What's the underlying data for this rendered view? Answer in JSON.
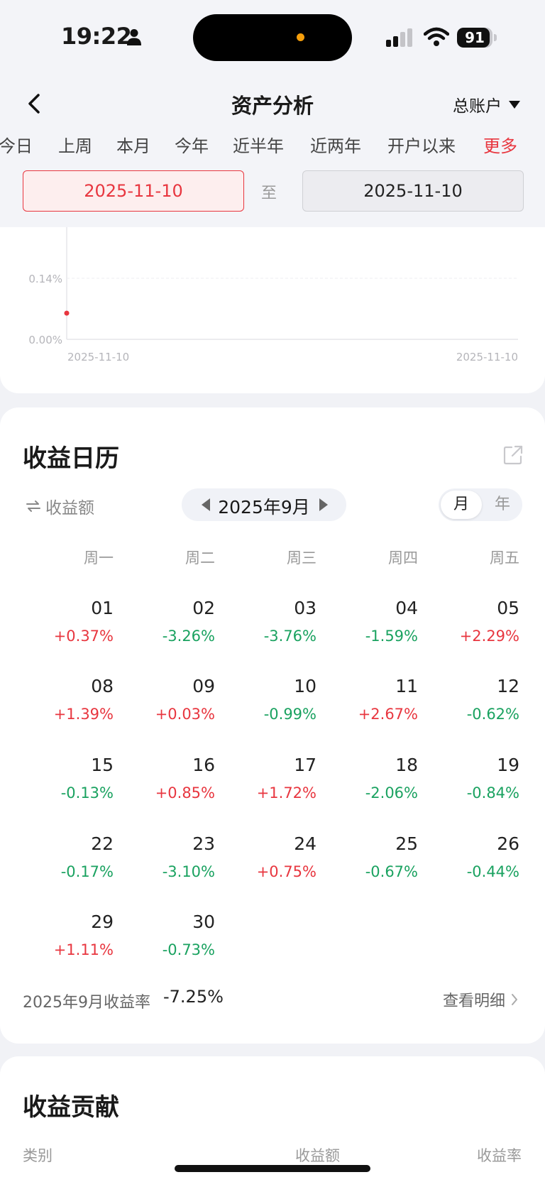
{
  "status_bar": {
    "time": "19:22",
    "battery": "91",
    "battery_level": 0.91
  },
  "header": {
    "title": "资产分析",
    "account": "总账户"
  },
  "period_tabs": [
    {
      "label": "今日",
      "active": false
    },
    {
      "label": "上周",
      "active": false
    },
    {
      "label": "本月",
      "active": false
    },
    {
      "label": "今年",
      "active": false
    },
    {
      "label": "近半年",
      "active": false
    },
    {
      "label": "近两年",
      "active": false
    },
    {
      "label": "开户以来",
      "active": false
    },
    {
      "label": "更多",
      "active": true
    }
  ],
  "date_range": {
    "start": "2025-11-10",
    "separator": "至",
    "end": "2025-11-10"
  },
  "chart_data": {
    "type": "line",
    "y_ticks": [
      "0.14%",
      "0.00%"
    ],
    "ylim": [
      0,
      0.14
    ],
    "x_ticks": [
      "2025-11-10",
      "2025-11-10"
    ],
    "series": [
      {
        "color": "#e8363f",
        "x": [
          "2025-11-10"
        ],
        "y": [
          0.06
        ]
      }
    ]
  },
  "calendar": {
    "title": "收益日历",
    "metric_toggle": "收益额",
    "month": "2025年9月",
    "granularity_month": "月",
    "granularity_year": "年",
    "weekdays": [
      "周一",
      "周二",
      "周三",
      "周四",
      "周五"
    ],
    "weeks": [
      [
        {
          "day": "01",
          "pct": "+0.37%"
        },
        {
          "day": "02",
          "pct": "-3.26%"
        },
        {
          "day": "03",
          "pct": "-3.76%"
        },
        {
          "day": "04",
          "pct": "-1.59%"
        },
        {
          "day": "05",
          "pct": "+2.29%"
        }
      ],
      [
        {
          "day": "08",
          "pct": "+1.39%"
        },
        {
          "day": "09",
          "pct": "+0.03%"
        },
        {
          "day": "10",
          "pct": "-0.99%"
        },
        {
          "day": "11",
          "pct": "+2.67%"
        },
        {
          "day": "12",
          "pct": "-0.62%"
        }
      ],
      [
        {
          "day": "15",
          "pct": "-0.13%"
        },
        {
          "day": "16",
          "pct": "+0.85%"
        },
        {
          "day": "17",
          "pct": "+1.72%"
        },
        {
          "day": "18",
          "pct": "-2.06%"
        },
        {
          "day": "19",
          "pct": "-0.84%"
        }
      ],
      [
        {
          "day": "22",
          "pct": "-0.17%"
        },
        {
          "day": "23",
          "pct": "-3.10%"
        },
        {
          "day": "24",
          "pct": "+0.75%"
        },
        {
          "day": "25",
          "pct": "-0.67%"
        },
        {
          "day": "26",
          "pct": "-0.44%"
        }
      ],
      [
        {
          "day": "29",
          "pct": "+1.11%"
        },
        {
          "day": "30",
          "pct": "-0.73%"
        }
      ]
    ],
    "summary_label": "2025年9月收益率",
    "summary_value": "-7.25%",
    "detail_link": "查看明细"
  },
  "contribution": {
    "title": "收益贡献",
    "columns": [
      "类别",
      "收益额",
      "收益率"
    ]
  },
  "colors": {
    "gain": "#e8363f",
    "loss": "#1aa260",
    "accent": "#e8363f"
  }
}
